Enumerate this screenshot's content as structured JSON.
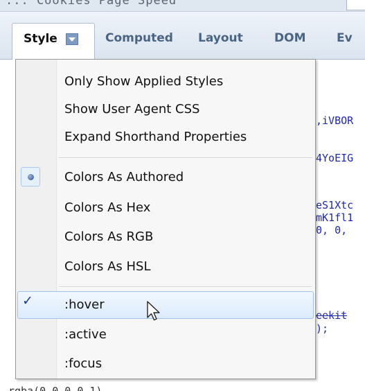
{
  "tabs": [
    {
      "label": "Style",
      "active": true
    },
    {
      "label": "Computed"
    },
    {
      "label": "Layout"
    },
    {
      "label": "DOM"
    },
    {
      "label": "Ev"
    }
  ],
  "top_fragment": "...    Cookies   Page Speed",
  "code_fragments": [
    ",iVBOR",
    "4YoEIG",
    "eS1Xtc",
    "mK1fl1",
    "0, 0,",
    "eekit",
    ");"
  ],
  "bottom_fragment": "rgba(0,0,0,0.1)",
  "menu": {
    "groups": [
      [
        {
          "label": "Only Show Applied Styles"
        },
        {
          "label": "Show User Agent CSS"
        },
        {
          "label": "Expand Shorthand Properties"
        }
      ],
      [
        {
          "label": "Colors As Authored",
          "state": "radio"
        },
        {
          "label": "Colors As Hex"
        },
        {
          "label": "Colors As RGB"
        },
        {
          "label": "Colors As HSL"
        }
      ],
      [
        {
          "label": ":hover",
          "state": "check",
          "hovered": true
        },
        {
          "label": ":active"
        },
        {
          "label": ":focus"
        }
      ]
    ]
  },
  "colors": {
    "accent": "#4a6584",
    "hover_border": "#9fc2ea",
    "code_text": "#1f2aa8"
  },
  "icons": {
    "dropdown": "chevron-down-icon",
    "radio": "radio-dot-icon",
    "check": "checkmark-icon",
    "cursor": "mouse-pointer-icon"
  }
}
